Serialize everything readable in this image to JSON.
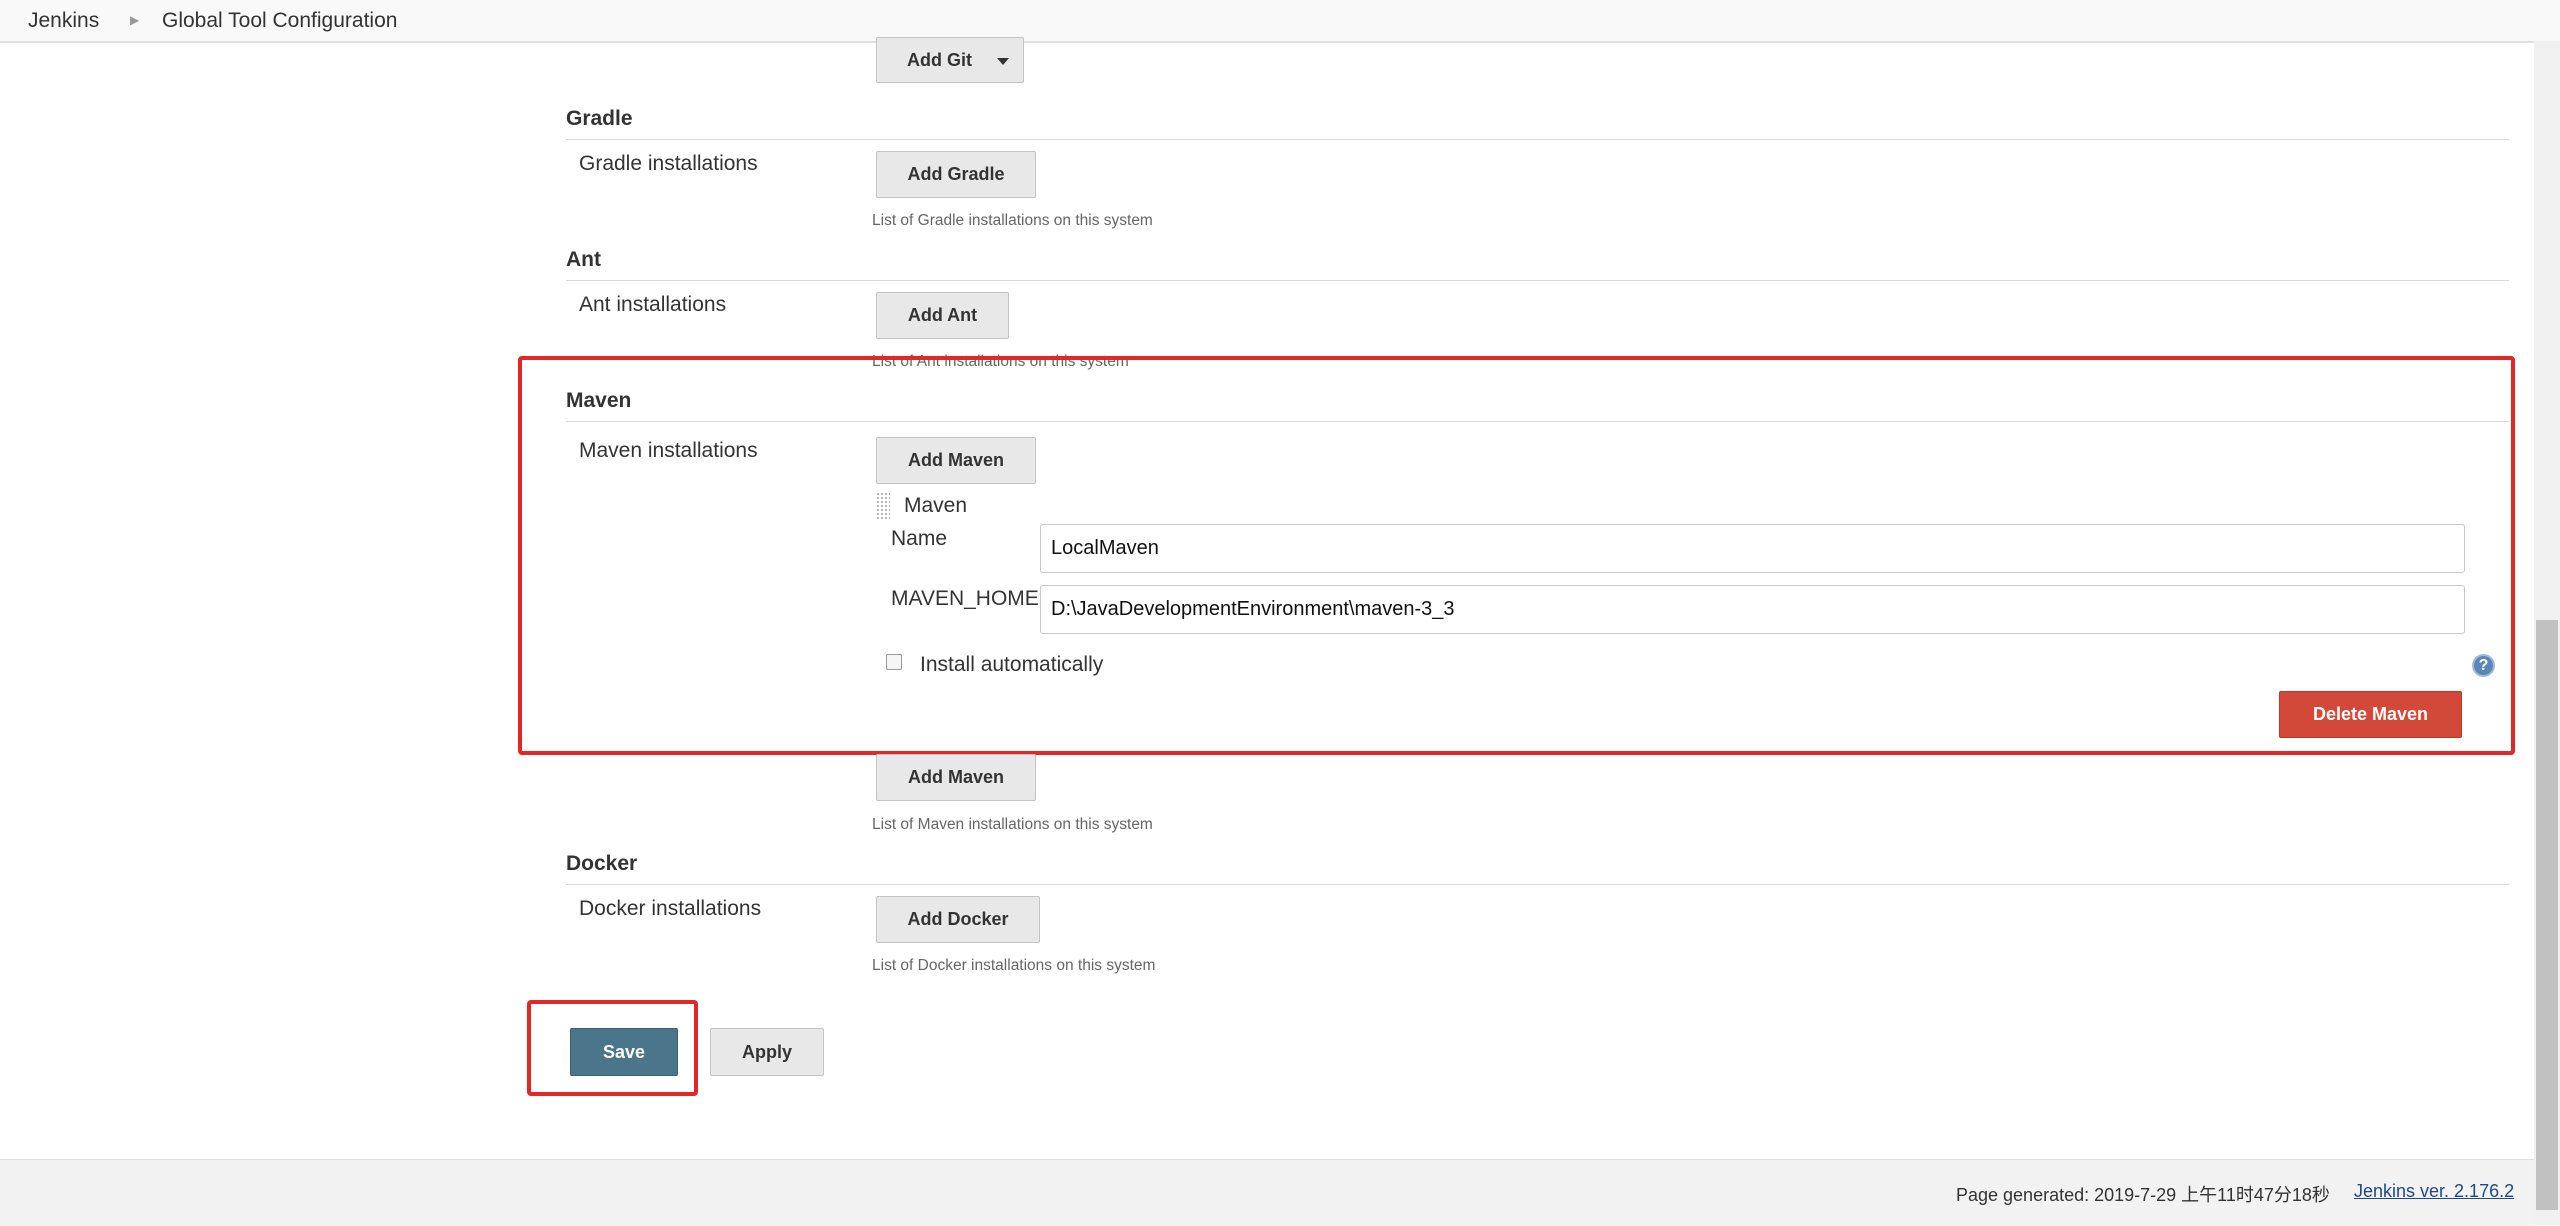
{
  "breadcrumb": {
    "items": [
      "Jenkins",
      "Global Tool Configuration"
    ]
  },
  "git": {
    "add_label": "Add Git"
  },
  "gradle": {
    "title": "Gradle",
    "installations_label": "Gradle installations",
    "add_label": "Add Gradle",
    "description": "List of Gradle installations on this system"
  },
  "ant": {
    "title": "Ant",
    "installations_label": "Ant installations",
    "add_label": "Add Ant",
    "description": "List of Ant installations on this system"
  },
  "maven": {
    "title": "Maven",
    "installations_label": "Maven installations",
    "add_label": "Add Maven",
    "installation": {
      "header": "Maven",
      "name_label": "Name",
      "name_value": "LocalMaven",
      "home_label": "MAVEN_HOME",
      "home_value": "D:\\JavaDevelopmentEnvironment\\maven-3_3",
      "install_auto_label": "Install automatically",
      "install_auto_checked": false,
      "delete_label": "Delete Maven"
    },
    "description": "List of Maven installations on this system"
  },
  "docker": {
    "title": "Docker",
    "installations_label": "Docker installations",
    "add_label": "Add Docker",
    "description": "List of Docker installations on this system"
  },
  "actions": {
    "save_label": "Save",
    "apply_label": "Apply"
  },
  "footer": {
    "page_generated": "Page generated: 2019-7-29 上午11时47分18秒",
    "version_link": "Jenkins ver. 2.176.2"
  },
  "icons": {
    "help": "help-icon",
    "drag": "drag-handle-icon",
    "caret": "caret-down-icon",
    "breadcrumb_separator": "chevron-right-icon"
  },
  "colors": {
    "primary_button": "#4b758b",
    "danger_button": "#d24939",
    "highlight": "#e32626",
    "link": "#204a87"
  }
}
